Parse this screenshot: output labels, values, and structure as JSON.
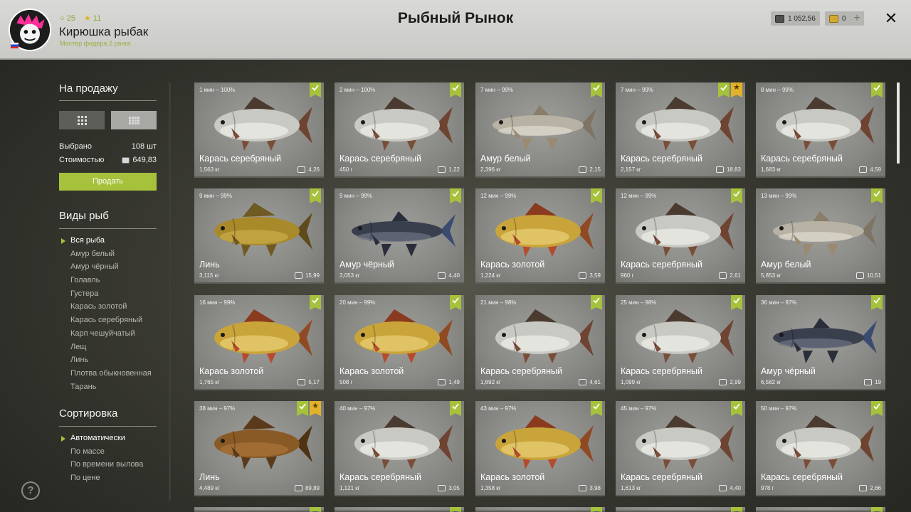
{
  "header": {
    "title": "Рыбный Рынок",
    "player": {
      "name": "Кирюшка рыбак",
      "rank": "Мастер фидера 2 ранга",
      "level": "25",
      "stars": "11"
    },
    "silver": "1 052,56",
    "gold": "0",
    "plus": "+",
    "close": "✕"
  },
  "sidebar": {
    "sale_heading": "На продажу",
    "selected_label": "Выбрано",
    "selected_value": "108 шт",
    "cost_label": "Стоимостью",
    "cost_value": "649,83",
    "sell_button": "Продать",
    "species_heading": "Виды рыб",
    "species": [
      "Вся рыба",
      "Амур белый",
      "Амур чёрный",
      "Голавль",
      "Густера",
      "Карась золотой",
      "Карась серебряный",
      "Карп чешуйчатый",
      "Лещ",
      "Линь",
      "Плотва обыкновенная",
      "Тарань"
    ],
    "species_active": 0,
    "sort_heading": "Сортировка",
    "sort": [
      "Автоматически",
      "По массе",
      "По времени вылова",
      "По цене"
    ],
    "sort_active": 0,
    "help": "?"
  },
  "colors": {
    "accent": "#a6c13b",
    "star": "#e2b22a"
  },
  "fish_styles": {
    "silver": {
      "body": "#c9c9c4",
      "belly": "#ecece8",
      "fin": "#7a4d38",
      "tail": "#6e4332",
      "dorsal": "#4a3a30"
    },
    "gold": {
      "body": "#c9a43a",
      "belly": "#e6cd74",
      "fin": "#b54a2c",
      "tail": "#8f4a24",
      "dorsal": "#8a3a1e"
    },
    "tench": {
      "body": "#a88a2a",
      "belly": "#c9aa48",
      "fin": "#6e5a22",
      "tail": "#5e4a1a",
      "dorsal": "#6e5a22"
    },
    "tench2": {
      "body": "#8a5a26",
      "belly": "#a8723a",
      "fin": "#5a3a1a",
      "tail": "#4e3214",
      "dorsal": "#5a3a1a"
    },
    "amur_white": {
      "body": "#b7b2a3",
      "belly": "#dcd8cc",
      "fin": "#9a8a72",
      "tail": "#7e7464",
      "dorsal": "#8a7e6a"
    },
    "amur_black": {
      "body": "#3a3f4e",
      "belly": "#6a7080",
      "fin": "#2a2e3a",
      "tail": "#3a4a70",
      "dorsal": "#2a2e3a"
    }
  },
  "cards": [
    {
      "time": "1 мин – 100%",
      "name": "Карась серебряный",
      "weight": "1,563 кг",
      "price": "4,26",
      "style": "silver",
      "star": false
    },
    {
      "time": "2 мин – 100%",
      "name": "Карась серебряный",
      "weight": "450 г",
      "price": "1,22",
      "style": "silver",
      "star": false
    },
    {
      "time": "7 мин – 99%",
      "name": "Амур белый",
      "weight": "2,396 кг",
      "price": "2,15",
      "style": "amur_white",
      "star": false
    },
    {
      "time": "7 мин – 99%",
      "name": "Карась серебряный",
      "weight": "2,157 кг",
      "price": "18,83",
      "style": "silver",
      "star": true
    },
    {
      "time": "8 мин – 99%",
      "name": "Карась серебряный",
      "weight": "1,683 кг",
      "price": "4,59",
      "style": "silver",
      "star": false
    },
    {
      "time": "9 мин – 99%",
      "name": "Линь",
      "weight": "3,115 кг",
      "price": "15,99",
      "style": "tench",
      "star": false
    },
    {
      "time": "9 мин – 99%",
      "name": "Амур чёрный",
      "weight": "3,053 кг",
      "price": "4,40",
      "style": "amur_black",
      "star": false
    },
    {
      "time": "12 мин – 99%",
      "name": "Карась золотой",
      "weight": "1,224 кг",
      "price": "3,59",
      "style": "gold",
      "star": false
    },
    {
      "time": "12 мин – 99%",
      "name": "Карась серебряный",
      "weight": "960 г",
      "price": "2,61",
      "style": "silver",
      "star": false
    },
    {
      "time": "13 мин – 99%",
      "name": "Амур белый",
      "weight": "5,853 кг",
      "price": "10,51",
      "style": "amur_white",
      "star": false
    },
    {
      "time": "16 мин – 99%",
      "name": "Карась золотой",
      "weight": "1,765 кг",
      "price": "5,17",
      "style": "gold",
      "star": false
    },
    {
      "time": "20 мин – 99%",
      "name": "Карась золотой",
      "weight": "508 г",
      "price": "1,49",
      "style": "gold",
      "star": false
    },
    {
      "time": "21 мин – 98%",
      "name": "Карась серебряный",
      "weight": "1,692 кг",
      "price": "4,61",
      "style": "silver",
      "star": false
    },
    {
      "time": "25 мин – 98%",
      "name": "Карась серебряный",
      "weight": "1,099 кг",
      "price": "2,99",
      "style": "silver",
      "star": false
    },
    {
      "time": "36 мин – 97%",
      "name": "Амур чёрный",
      "weight": "6,582 кг",
      "price": "19",
      "style": "amur_black",
      "star": false
    },
    {
      "time": "38 мин – 97%",
      "name": "Линь",
      "weight": "4,489 кг",
      "price": "89,89",
      "style": "tench2",
      "star": true
    },
    {
      "time": "40 мин – 97%",
      "name": "Карась серебряный",
      "weight": "1,121 кг",
      "price": "3,05",
      "style": "silver",
      "star": false
    },
    {
      "time": "43 мин – 97%",
      "name": "Карась золотой",
      "weight": "1,358 кг",
      "price": "3,98",
      "style": "gold",
      "star": false
    },
    {
      "time": "45 мин – 97%",
      "name": "Карась серебряный",
      "weight": "1,613 кг",
      "price": "4,40",
      "style": "silver",
      "star": false
    },
    {
      "time": "50 мин – 97%",
      "name": "Карась серебряный",
      "weight": "978 г",
      "price": "2,66",
      "style": "silver",
      "star": false
    }
  ]
}
